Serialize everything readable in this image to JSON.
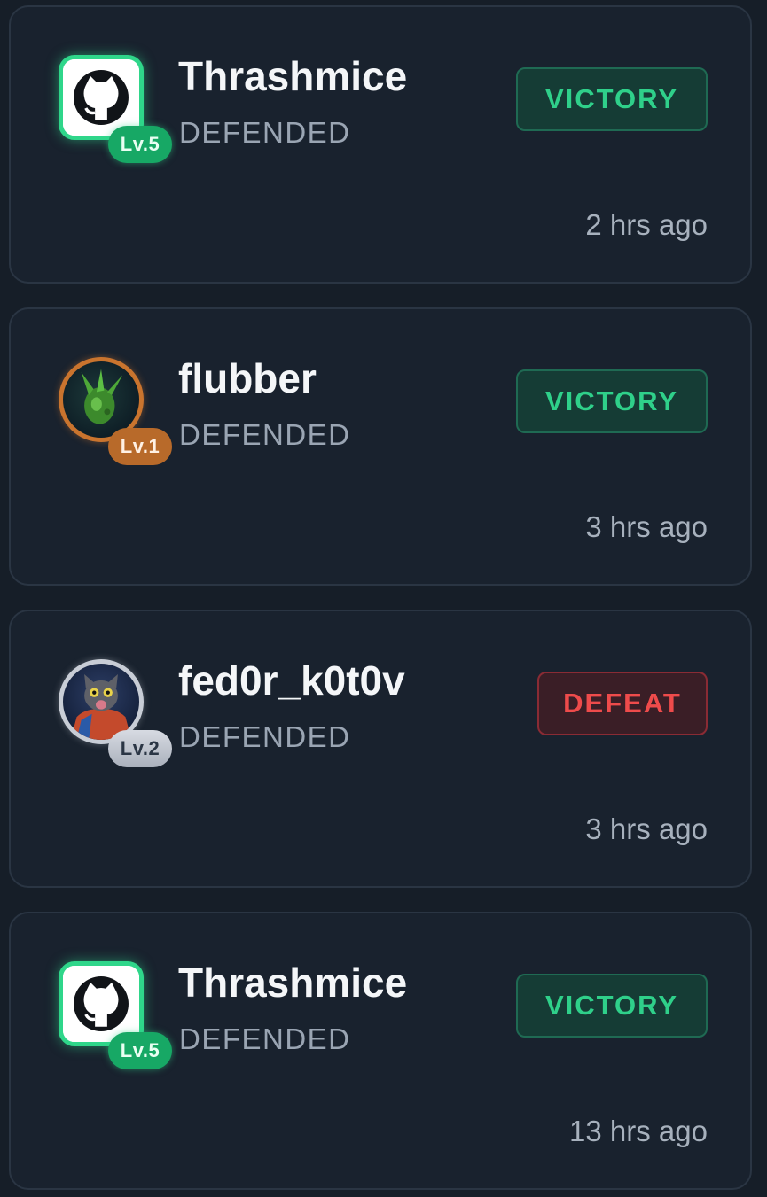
{
  "battles": [
    {
      "username": "Thrashmice",
      "level": "Lv.5",
      "status": "DEFENDED",
      "result": "VICTORY",
      "time": "2 hrs ago",
      "avatar": "github-icon",
      "tier_color": "#2fd68a"
    },
    {
      "username": "flubber",
      "level": "Lv.1",
      "status": "DEFENDED",
      "result": "VICTORY",
      "time": "3 hrs ago",
      "avatar": "green-creature-avatar",
      "tier_color": "#c9742e"
    },
    {
      "username": "fed0r_k0t0v",
      "level": "Lv.2",
      "status": "DEFENDED",
      "result": "DEFEAT",
      "time": "3 hrs ago",
      "avatar": "cat-avatar",
      "tier_color": "#c8cdd6"
    },
    {
      "username": "Thrashmice",
      "level": "Lv.5",
      "status": "DEFENDED",
      "result": "VICTORY",
      "time": "13 hrs ago",
      "avatar": "github-icon",
      "tier_color": "#2fd68a"
    }
  ],
  "colors": {
    "victory": "#2fd08a",
    "defeat": "#ee4b4b",
    "card_background": "#19222e",
    "page_background": "#161e28"
  }
}
